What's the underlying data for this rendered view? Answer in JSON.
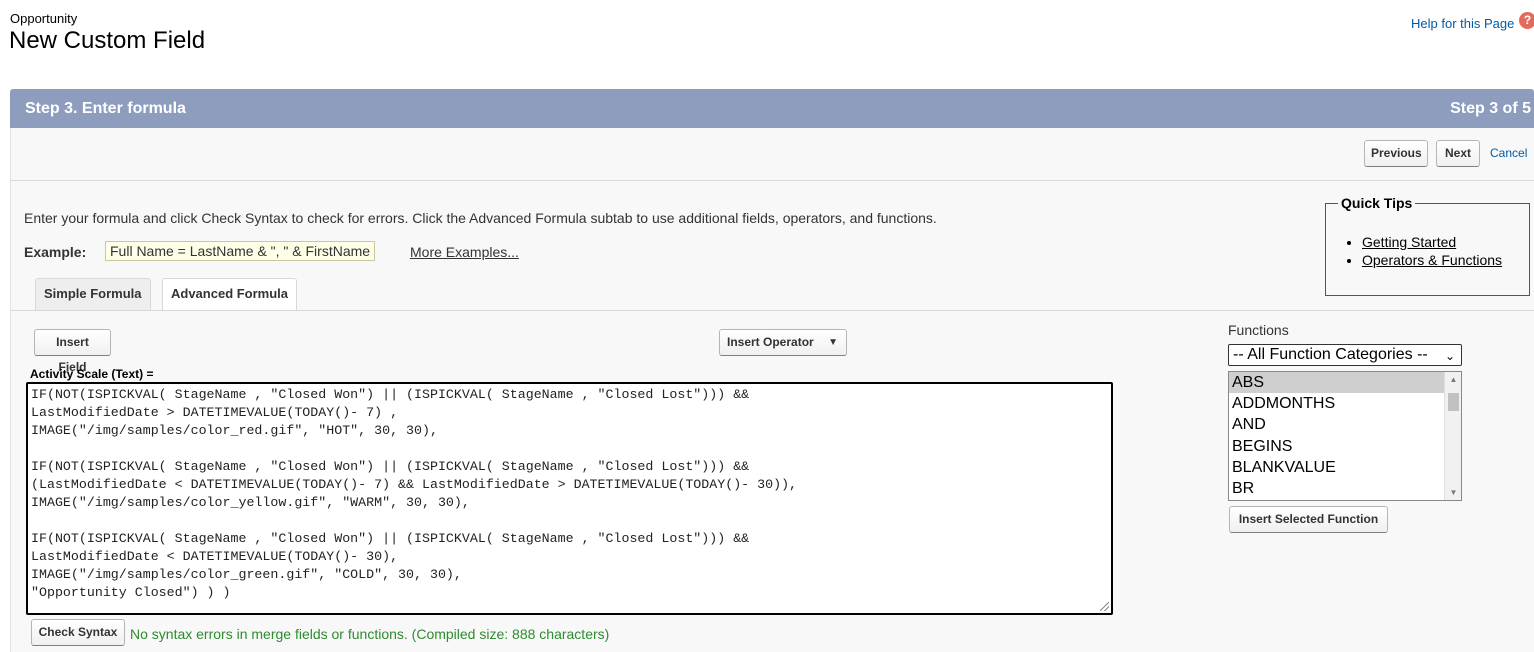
{
  "header": {
    "object_label": "Opportunity",
    "title": "New Custom Field",
    "help_link": "Help for this Page",
    "help_icon": "?"
  },
  "step_bar": {
    "title": "Step 3. Enter formula",
    "counter": "Step 3 of 5"
  },
  "nav": {
    "previous": "Previous",
    "next": "Next",
    "cancel": "Cancel"
  },
  "quick_tips": {
    "title": "Quick Tips",
    "links": [
      "Getting Started",
      "Operators & Functions"
    ]
  },
  "intro_text": "Enter your formula and click Check Syntax to check for errors. Click the Advanced Formula subtab to use additional fields, operators, and functions.",
  "example": {
    "label": "Example:",
    "value": "Full Name = LastName & \", \" & FirstName",
    "more_link": "More Examples..."
  },
  "tabs": [
    {
      "label": "Simple Formula",
      "active": false
    },
    {
      "label": "Advanced Formula",
      "active": true
    }
  ],
  "toolbar": {
    "insert_field": "Insert Field",
    "insert_operator": "Insert Operator"
  },
  "formula": {
    "label": "Activity Scale (Text) =",
    "text": "IF(NOT(ISPICKVAL( StageName , \"Closed Won\") || (ISPICKVAL( StageName , \"Closed Lost\"))) &&\nLastModifiedDate > DATETIMEVALUE(TODAY()- 7) ,\nIMAGE(\"/img/samples/color_red.gif\", \"HOT\", 30, 30),\n\nIF(NOT(ISPICKVAL( StageName , \"Closed Won\") || (ISPICKVAL( StageName , \"Closed Lost\"))) &&\n(LastModifiedDate < DATETIMEVALUE(TODAY()- 7) && LastModifiedDate > DATETIMEVALUE(TODAY()- 30)),\nIMAGE(\"/img/samples/color_yellow.gif\", \"WARM\", 30, 30),\n\nIF(NOT(ISPICKVAL( StageName , \"Closed Won\") || (ISPICKVAL( StageName , \"Closed Lost\"))) &&\nLastModifiedDate < DATETIMEVALUE(TODAY()- 30),\nIMAGE(\"/img/samples/color_green.gif\", \"COLD\", 30, 30),\n\"Opportunity Closed\") ) )"
  },
  "check_syntax": {
    "button": "Check Syntax",
    "status": "No syntax errors in merge fields or functions. (Compiled size: 888 characters)",
    "status_color": "#2e8b2e"
  },
  "functions": {
    "label": "Functions",
    "category_selected": "-- All Function Categories --",
    "items": [
      "ABS",
      "ADDMONTHS",
      "AND",
      "BEGINS",
      "BLANKVALUE",
      "BR"
    ],
    "selected": "ABS",
    "insert_button": "Insert Selected Function"
  },
  "colors": {
    "step_bar": "#8e9dbe",
    "link": "#015ba7",
    "help_icon": "#e26b5c"
  }
}
